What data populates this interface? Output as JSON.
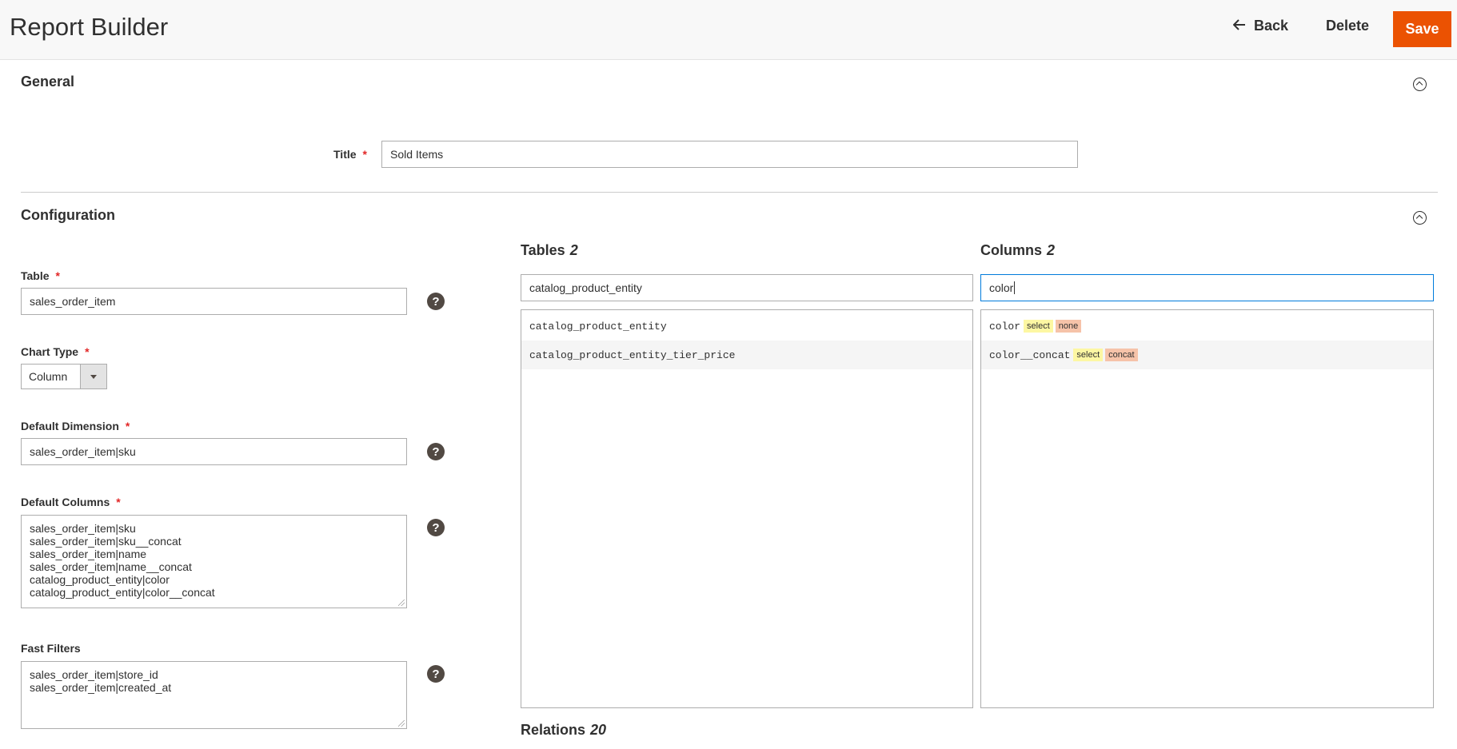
{
  "header": {
    "title": "Report Builder",
    "back_label": "Back",
    "delete_label": "Delete",
    "save_label": "Save"
  },
  "general": {
    "section_title": "General",
    "title_label": "Title",
    "title_value": "Sold Items"
  },
  "configuration": {
    "section_title": "Configuration",
    "table_label": "Table",
    "table_value": "sales_order_item",
    "chart_type_label": "Chart Type",
    "chart_type_value": "Column",
    "default_dimension_label": "Default Dimension",
    "default_dimension_value": "sales_order_item|sku",
    "default_columns_label": "Default Columns",
    "default_columns": [
      "sales_order_item|sku",
      "sales_order_item|sku__concat",
      "sales_order_item|name",
      "sales_order_item|name__concat",
      "catalog_product_entity|color",
      "catalog_product_entity|color__concat"
    ],
    "fast_filters_label": "Fast Filters",
    "fast_filters": [
      "sales_order_item|store_id",
      "sales_order_item|created_at"
    ],
    "required_mark": "*",
    "help_glyph": "?"
  },
  "tables_panel": {
    "title": "Tables",
    "count": "2",
    "search_value": "catalog_product_entity",
    "items": [
      "catalog_product_entity",
      "catalog_product_entity_tier_price"
    ]
  },
  "columns_panel": {
    "title": "Columns",
    "count": "2",
    "search_value": "color",
    "items": [
      {
        "name": "color",
        "tag1": "select",
        "tag2": "none"
      },
      {
        "name": "color__concat",
        "tag1": "select",
        "tag2": "concat"
      }
    ]
  },
  "relations_panel": {
    "title": "Relations",
    "count": "20"
  },
  "colors": {
    "accent": "#eb5202",
    "required": "#e22626",
    "focus_border": "#007bdb",
    "select_tag": "#fdf7a3",
    "aggregate_tag": "#f6c3a9"
  }
}
